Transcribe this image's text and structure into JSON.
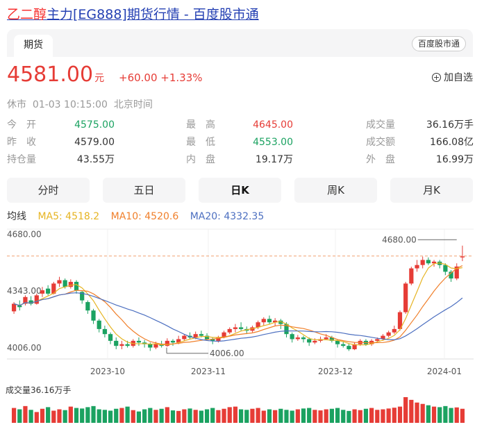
{
  "title": {
    "highlight": "乙二醇",
    "rest": "主力[EG888]期货行情 - 百度股市通"
  },
  "tab": {
    "active": "期货",
    "badge": "百度股市通"
  },
  "quote": {
    "price": "4581.00",
    "unit": "元",
    "change": "+60.00",
    "change_pct": "+1.33%",
    "watch_label": "加自选",
    "status": "休市",
    "time": "01-03 10:15:00",
    "tz": "北京时间"
  },
  "stats": {
    "col1": [
      {
        "label": "今　开",
        "value": "4575.00",
        "color": "green"
      },
      {
        "label": "昨　收",
        "value": "4579.00",
        "color": "plain"
      },
      {
        "label": "持仓量",
        "value": "43.55万",
        "color": "plain"
      }
    ],
    "col2": [
      {
        "label": "最　高",
        "value": "4645.00",
        "color": "red"
      },
      {
        "label": "最　低",
        "value": "4553.00",
        "color": "green"
      },
      {
        "label": "内　盘",
        "value": "19.17万",
        "color": "plain"
      }
    ],
    "col3": [
      {
        "label": "成交量",
        "value": "36.16万手"
      },
      {
        "label": "成交额",
        "value": "166.08亿"
      },
      {
        "label": "外　盘",
        "value": "16.99万"
      }
    ]
  },
  "ktabs": [
    "分时",
    "五日",
    "日K",
    "周K",
    "月K"
  ],
  "ktab_active": 2,
  "ma": {
    "label": "均线",
    "ma5": "MA5: 4518.2",
    "ma10": "MA10: 4520.6",
    "ma20": "MA20: 4332.35",
    "colors": {
      "ma5": "#e6b422",
      "ma10": "#f07f2a",
      "ma20": "#4c6fc0"
    }
  },
  "colors": {
    "up": "#e63c36",
    "down": "#1ba261",
    "accent": "#2440b3"
  },
  "volume_label": "成交量36.16万手",
  "chart_data": {
    "type": "candlestick",
    "y_ticks": [
      "4680.00",
      "4343.00",
      "4006.00"
    ],
    "ylim": [
      3960,
      4710
    ],
    "x_ticks": [
      "2023-10",
      "2023-11",
      "2023-12",
      "2024-01"
    ],
    "max_annotation": "4680.00",
    "min_annotation": "4006.00",
    "ref_price": 4579,
    "candles": [
      [
        4255,
        4300,
        4240,
        4310
      ],
      [
        4290,
        4280,
        4260,
        4320
      ],
      [
        4300,
        4340,
        4290,
        4350
      ],
      [
        4320,
        4300,
        4290,
        4345
      ],
      [
        4300,
        4350,
        4295,
        4360
      ],
      [
        4360,
        4380,
        4340,
        4400
      ],
      [
        4390,
        4360,
        4350,
        4410
      ],
      [
        4360,
        4420,
        4355,
        4430
      ],
      [
        4420,
        4440,
        4400,
        4460
      ],
      [
        4440,
        4400,
        4390,
        4450
      ],
      [
        4400,
        4430,
        4390,
        4445
      ],
      [
        4430,
        4380,
        4360,
        4440
      ],
      [
        4370,
        4320,
        4300,
        4380
      ],
      [
        4310,
        4260,
        4240,
        4320
      ],
      [
        4260,
        4200,
        4180,
        4270
      ],
      [
        4200,
        4150,
        4130,
        4210
      ],
      [
        4150,
        4120,
        4100,
        4170
      ],
      [
        4120,
        4080,
        4060,
        4130
      ],
      [
        4080,
        4050,
        4030,
        4100
      ],
      [
        4050,
        4060,
        4030,
        4080
      ],
      [
        4060,
        4050,
        4040,
        4080
      ],
      [
        4050,
        4080,
        4040,
        4090
      ],
      [
        4080,
        4070,
        4050,
        4100
      ],
      [
        4070,
        4060,
        4040,
        4085
      ],
      [
        4060,
        4040,
        4020,
        4070
      ],
      [
        4040,
        4060,
        4030,
        4075
      ],
      [
        4060,
        4050,
        4040,
        4080
      ],
      [
        4050,
        4080,
        4045,
        4095
      ],
      [
        4080,
        4070,
        4050,
        4090
      ],
      [
        4070,
        4090,
        4060,
        4110
      ],
      [
        4090,
        4110,
        4080,
        4120
      ],
      [
        4110,
        4100,
        4090,
        4130
      ],
      [
        4100,
        4120,
        4090,
        4135
      ],
      [
        4120,
        4110,
        4100,
        4140
      ],
      [
        4110,
        4090,
        4080,
        4125
      ],
      [
        4090,
        4080,
        4060,
        4100
      ],
      [
        4080,
        4100,
        4070,
        4110
      ],
      [
        4100,
        4130,
        4095,
        4140
      ],
      [
        4130,
        4150,
        4120,
        4160
      ],
      [
        4150,
        4160,
        4130,
        4180
      ],
      [
        4160,
        4150,
        4140,
        4190
      ],
      [
        4150,
        4140,
        4120,
        4165
      ],
      [
        4140,
        4160,
        4130,
        4170
      ],
      [
        4160,
        4190,
        4150,
        4200
      ],
      [
        4190,
        4210,
        4170,
        4220
      ],
      [
        4210,
        4190,
        4180,
        4230
      ],
      [
        4190,
        4200,
        4170,
        4215
      ],
      [
        4200,
        4180,
        4150,
        4210
      ],
      [
        4180,
        4120,
        4100,
        4190
      ],
      [
        4120,
        4090,
        4070,
        4130
      ],
      [
        4090,
        4100,
        4080,
        4115
      ],
      [
        4100,
        4090,
        4070,
        4110
      ],
      [
        4090,
        4070,
        4050,
        4100
      ],
      [
        4070,
        4080,
        4060,
        4095
      ],
      [
        4080,
        4090,
        4070,
        4105
      ],
      [
        4090,
        4100,
        4085,
        4120
      ],
      [
        4100,
        4080,
        4070,
        4110
      ],
      [
        4080,
        4060,
        4040,
        4090
      ],
      [
        4060,
        4050,
        4040,
        4075
      ],
      [
        4050,
        4030,
        4020,
        4065
      ],
      [
        4030,
        4060,
        4025,
        4070
      ],
      [
        4060,
        4080,
        4050,
        4090
      ],
      [
        4080,
        4060,
        4050,
        4090
      ],
      [
        4060,
        4080,
        4050,
        4090
      ],
      [
        4080,
        4090,
        4070,
        4100
      ],
      [
        4090,
        4110,
        4080,
        4120
      ],
      [
        4110,
        4130,
        4100,
        4140
      ],
      [
        4130,
        4150,
        4120,
        4170
      ],
      [
        4150,
        4250,
        4140,
        4260
      ],
      [
        4250,
        4420,
        4240,
        4430
      ],
      [
        4420,
        4510,
        4410,
        4520
      ],
      [
        4510,
        4530,
        4490,
        4560
      ],
      [
        4530,
        4560,
        4510,
        4580
      ],
      [
        4560,
        4540,
        4530,
        4575
      ],
      [
        4540,
        4550,
        4520,
        4560
      ],
      [
        4550,
        4530,
        4510,
        4560
      ],
      [
        4530,
        4490,
        4470,
        4540
      ],
      [
        4490,
        4450,
        4430,
        4500
      ],
      [
        4450,
        4521,
        4440,
        4540
      ],
      [
        4575,
        4581,
        4553,
        4645
      ]
    ],
    "volumes": [
      55,
      50,
      62,
      48,
      40,
      52,
      58,
      45,
      50,
      47,
      60,
      55,
      53,
      58,
      62,
      50,
      48,
      45,
      52,
      55,
      60,
      47,
      42,
      50,
      55,
      48,
      52,
      58,
      46,
      44,
      50,
      53,
      48,
      45,
      50,
      55,
      47,
      52,
      58,
      60,
      50,
      48,
      52,
      55,
      45,
      50,
      47,
      52,
      48,
      45,
      50,
      53,
      55,
      48,
      46,
      50,
      52,
      55,
      48,
      44,
      50,
      47,
      52,
      55,
      48,
      50,
      53,
      56,
      60,
      95,
      85,
      75,
      70,
      65,
      60,
      58,
      62,
      55,
      57,
      52
    ]
  }
}
